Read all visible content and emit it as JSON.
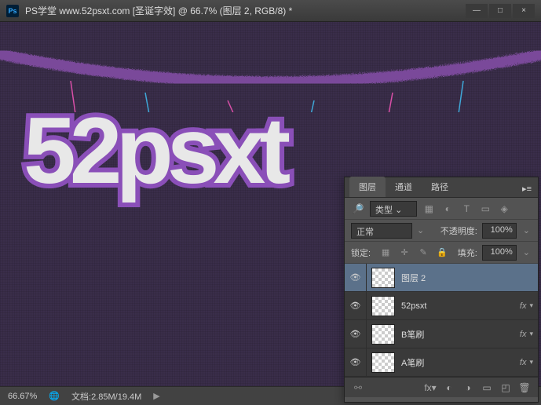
{
  "titlebar": {
    "ps_label": "Ps",
    "title": "PS学堂  www.52psxt.com [圣诞字效] @ 66.7% (图层 2, RGB/8) *"
  },
  "win_btns": {
    "min": "—",
    "max": "□",
    "close": "×"
  },
  "canvas_text": "52psxt",
  "statusbar": {
    "zoom": "66.67%",
    "doc": "文档:2.85M/19.4M",
    "arrow": "▶"
  },
  "layers_panel": {
    "tabs": {
      "layers": "图层",
      "channels": "通道",
      "paths": "路径"
    },
    "menu": "▸≡",
    "kind_icon": "🔎",
    "kind_label": "类型",
    "kind_arrow": "⌄",
    "filter_icons": {
      "img": "▦",
      "adj": "◐",
      "type": "T",
      "shape": "▭",
      "smart": "◈"
    },
    "blend": "正常",
    "blend_arrow": "⌄",
    "opacity_label": "不透明度:",
    "opacity_val": "100%",
    "lock_label": "锁定:",
    "lock_icons": {
      "pixels": "▦",
      "pos": "✛",
      "brush": "✎",
      "all": "🔒"
    },
    "fill_label": "填充:",
    "fill_val": "100%",
    "layers": [
      {
        "name": "图层 2",
        "fx": false,
        "selected": true
      },
      {
        "name": "52psxt",
        "fx": true,
        "selected": false
      },
      {
        "name": "B笔刷",
        "fx": true,
        "selected": false
      },
      {
        "name": "A笔刷",
        "fx": true,
        "selected": false
      }
    ],
    "fx_text": "fx",
    "fx_arrow": "▾",
    "eye": "👁",
    "footer_icons": {
      "link": "⚯",
      "fx": "fx▾",
      "mask": "◐",
      "adj": "◑",
      "group": "▭",
      "new": "◰",
      "trash": "🗑"
    }
  }
}
